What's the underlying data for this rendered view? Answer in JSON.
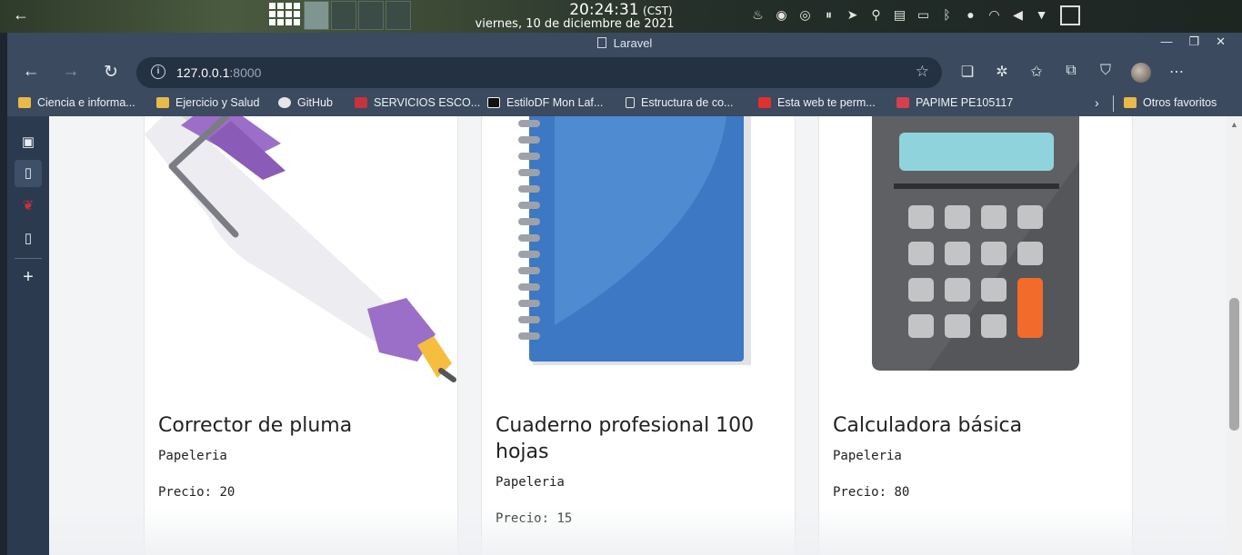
{
  "os_bar": {
    "time": "20:24:31",
    "timezone": "(CST)",
    "date": "viernes, 10 de diciembre de 2021",
    "tray_icons": [
      "notification-icon",
      "record-icon",
      "sync-icon",
      "pause-icon",
      "telegram-icon",
      "location-icon",
      "clipboard-icon",
      "battery-icon",
      "bluetooth-icon",
      "microphone-icon",
      "wifi-icon",
      "volume-icon",
      "dropdown-icon"
    ]
  },
  "browser": {
    "window_title": "Laravel",
    "url_host": "127.0.0.1",
    "url_port": ":8000",
    "bookmarks": [
      {
        "label": "Ciencia e informa...",
        "icon": "folder-icon"
      },
      {
        "label": "Ejercicio y Salud",
        "icon": "folder-icon"
      },
      {
        "label": "GitHub",
        "icon": "github-icon"
      },
      {
        "label": "SERVICIOS ESCO...",
        "icon": "school-icon"
      },
      {
        "label": "EstiloDF Mon Laf...",
        "icon": "site-icon"
      },
      {
        "label": "Estructura de co...",
        "icon": "document-icon"
      },
      {
        "label": "Esta web te perm...",
        "icon": "ch-icon"
      },
      {
        "label": "PAPIME PE105117",
        "icon": "papime-icon"
      }
    ],
    "other_bookmarks": "Otros favoritos"
  },
  "products": [
    {
      "name": "Corrector de pluma",
      "category": "Papeleria",
      "price_label": "Precio:",
      "price": "20",
      "image": "pen-corrector-image"
    },
    {
      "name": "Cuaderno profesional 100 hojas",
      "category": "Papeleria",
      "price_label": "Precio:",
      "price": "15",
      "image": "notebook-image"
    },
    {
      "name": "Calculadora básica",
      "category": "Papeleria",
      "price_label": "Precio:",
      "price": "80",
      "image": "calculator-image"
    }
  ],
  "colors": {
    "chrome": "#3b4a5e",
    "pen_purple": "#9b6fc7",
    "notebook_blue": "#3c78c4",
    "calculator_screen": "#8fd4dc",
    "calculator_orange": "#f36b2b"
  }
}
